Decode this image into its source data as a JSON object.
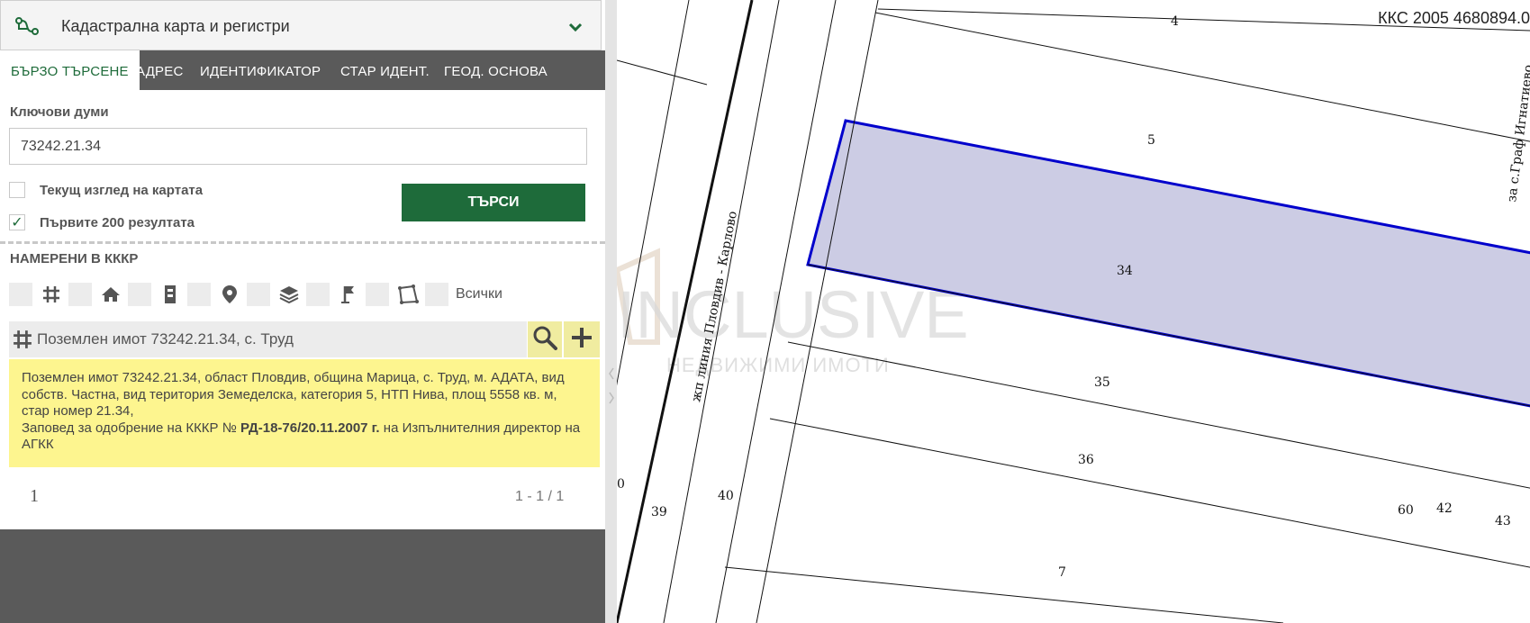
{
  "app": {
    "title": "Кадастрална карта и регистри"
  },
  "tabs": [
    {
      "label": "БЪРЗО ТЪРСЕНЕ",
      "active": true
    },
    {
      "label": "АДРЕС",
      "active": false
    },
    {
      "label": "ИДЕНТИФИКАТОР",
      "active": false
    },
    {
      "label": "СТАР ИДЕНТ.",
      "active": false
    },
    {
      "label": "ГЕОД. ОСНОВА",
      "active": false
    }
  ],
  "search": {
    "keywords_label": "Ключови думи",
    "value": "73242.21.34",
    "current_view_label": "Текущ изглед на картата",
    "current_view_checked": false,
    "first200_label": "Първите 200 резултата",
    "first200_checked": true,
    "check_mark": "✓",
    "button_label": "ТЪРСИ"
  },
  "results": {
    "title": "НАМЕРЕНИ В КККР",
    "filter_all_label": "Всички",
    "filter_icons": [
      "grid-icon",
      "house-icon",
      "building-icon",
      "location-pin-icon",
      "layers-icon",
      "flag-icon",
      "polygon-icon"
    ],
    "item_title": "Поземлен имот 73242.21.34, с. Труд",
    "details": {
      "line1": "Поземлен имот 73242.21.34, област Пловдив, община Марица, с. Труд, м. АДАТА, вид собств. Частна, вид територия Земеделска, категория 5, НТП Нива, площ 5558 кв. м, стар номер 21.34,",
      "order_prefix": "Заповед за одобрение на КККР №",
      "order_number": "РД-18-76/20.11.2007 г.",
      "order_suffix": "на Изпълнителния директор на АГКК"
    },
    "page": "1",
    "range": "1 - 1 / 1"
  },
  "map": {
    "coordinate_readout": "ККС 2005 4680894.0",
    "parcel_labels": [
      "4",
      "5",
      "34",
      "35",
      "36",
      "7",
      "39",
      "40",
      "60",
      "42",
      "43",
      "0"
    ],
    "road_label_left": "жп линия Пловдив - Карлово",
    "road_label_right": "за с.Граф Игнатиево",
    "watermark_main": "INCLUSIVE",
    "watermark_sub": "НЕДВИЖИМИ ИМОТИ",
    "highlight_color": "#cccce4",
    "highlight_stroke": "#0000cc"
  },
  "colors": {
    "brand_green": "#1e6b3a",
    "info_bg": "#fdf58f",
    "panel_gray": "#5a5a5a"
  }
}
